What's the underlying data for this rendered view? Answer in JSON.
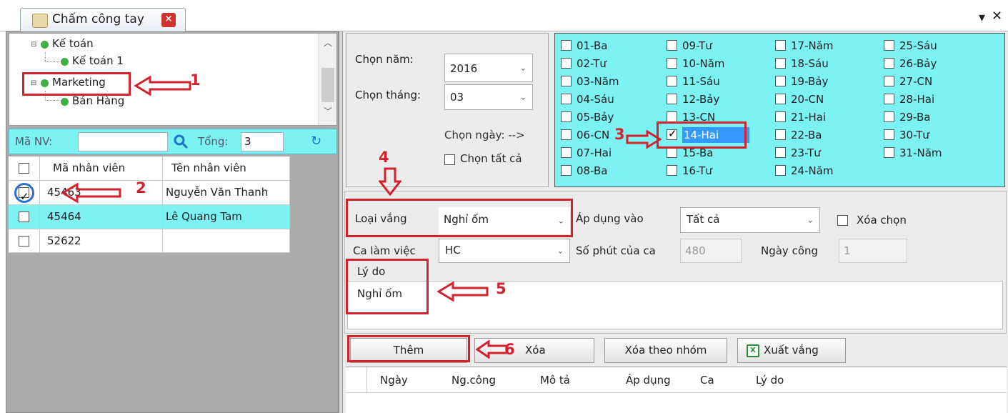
{
  "tab": {
    "title": "Chấm công tay"
  },
  "window_controls": {
    "menu": "▾",
    "close": "✕"
  },
  "tree": {
    "items": [
      "Kế toán",
      "Kế toán 1",
      "Marketing",
      "Bán Hàng"
    ]
  },
  "search": {
    "label": "Mã NV:",
    "value": "",
    "total_label": "Tổng:",
    "total_value": "3"
  },
  "employees": {
    "headers": [
      "Mã nhân viên",
      "Tên nhân viên"
    ],
    "rows": [
      {
        "id": "45463",
        "name": "Nguyễn Văn Thanh",
        "checked": true
      },
      {
        "id": "45464",
        "name": "Lê Quang Tam",
        "checked": false
      },
      {
        "id": "52622",
        "name": "",
        "checked": false
      }
    ]
  },
  "date_select": {
    "year_label": "Chọn năm:",
    "year_value": "2016",
    "month_label": "Chọn tháng:",
    "month_value": "03",
    "day_hint": "Chọn ngày: -->",
    "select_all_label": "Chọn tất cả"
  },
  "days": [
    [
      "01-Ba",
      "02-Tư",
      "03-Năm",
      "04-Sáu",
      "05-Bảy",
      "06-CN",
      "07-Hai",
      "08-Ba"
    ],
    [
      "09-Tư",
      "10-Năm",
      "11-Sáu",
      "12-Bảy",
      "13-CN",
      "14-Hai",
      "15-Ba",
      "16-Tư"
    ],
    [
      "17-Năm",
      "18-Sáu",
      "19-Bảy",
      "20-CN",
      "21-Hai",
      "22-Ba",
      "23-Tư",
      "24-Năm"
    ],
    [
      "25-Sáu",
      "26-Bảy",
      "27-CN",
      "28-Hai",
      "29-Ba",
      "30-Tư",
      "31-Năm"
    ]
  ],
  "selected_day": "14-Hai",
  "form": {
    "absence_type_label": "Loại vắng",
    "absence_type_value": "Nghỉ ốm",
    "apply_label": "Áp dụng vào",
    "apply_value": "Tất cả",
    "clear_selection_label": "Xóa chọn",
    "shift_label": "Ca làm việc",
    "shift_value": "HC",
    "minutes_label": "Số phút của ca",
    "minutes_value": "480",
    "workday_label": "Ngày công",
    "workday_value": "1",
    "reason_label": "Lý do",
    "reason_value": "Nghỉ ốm"
  },
  "buttons": {
    "add": "Thêm",
    "delete": "Xóa",
    "delete_group": "Xóa theo nhóm",
    "export": "Xuất vắng"
  },
  "records": {
    "headers": [
      "Ngày",
      "Ng.công",
      "Mô tả",
      "Áp dụng",
      "Ca",
      "Lý do"
    ]
  },
  "annotations": [
    "1",
    "2",
    "3",
    "4",
    "5",
    "6"
  ],
  "colors": {
    "accent_cyan": "#7df2f2",
    "annotation_red": "#d3212d",
    "selected_blue": "#3399ff"
  }
}
